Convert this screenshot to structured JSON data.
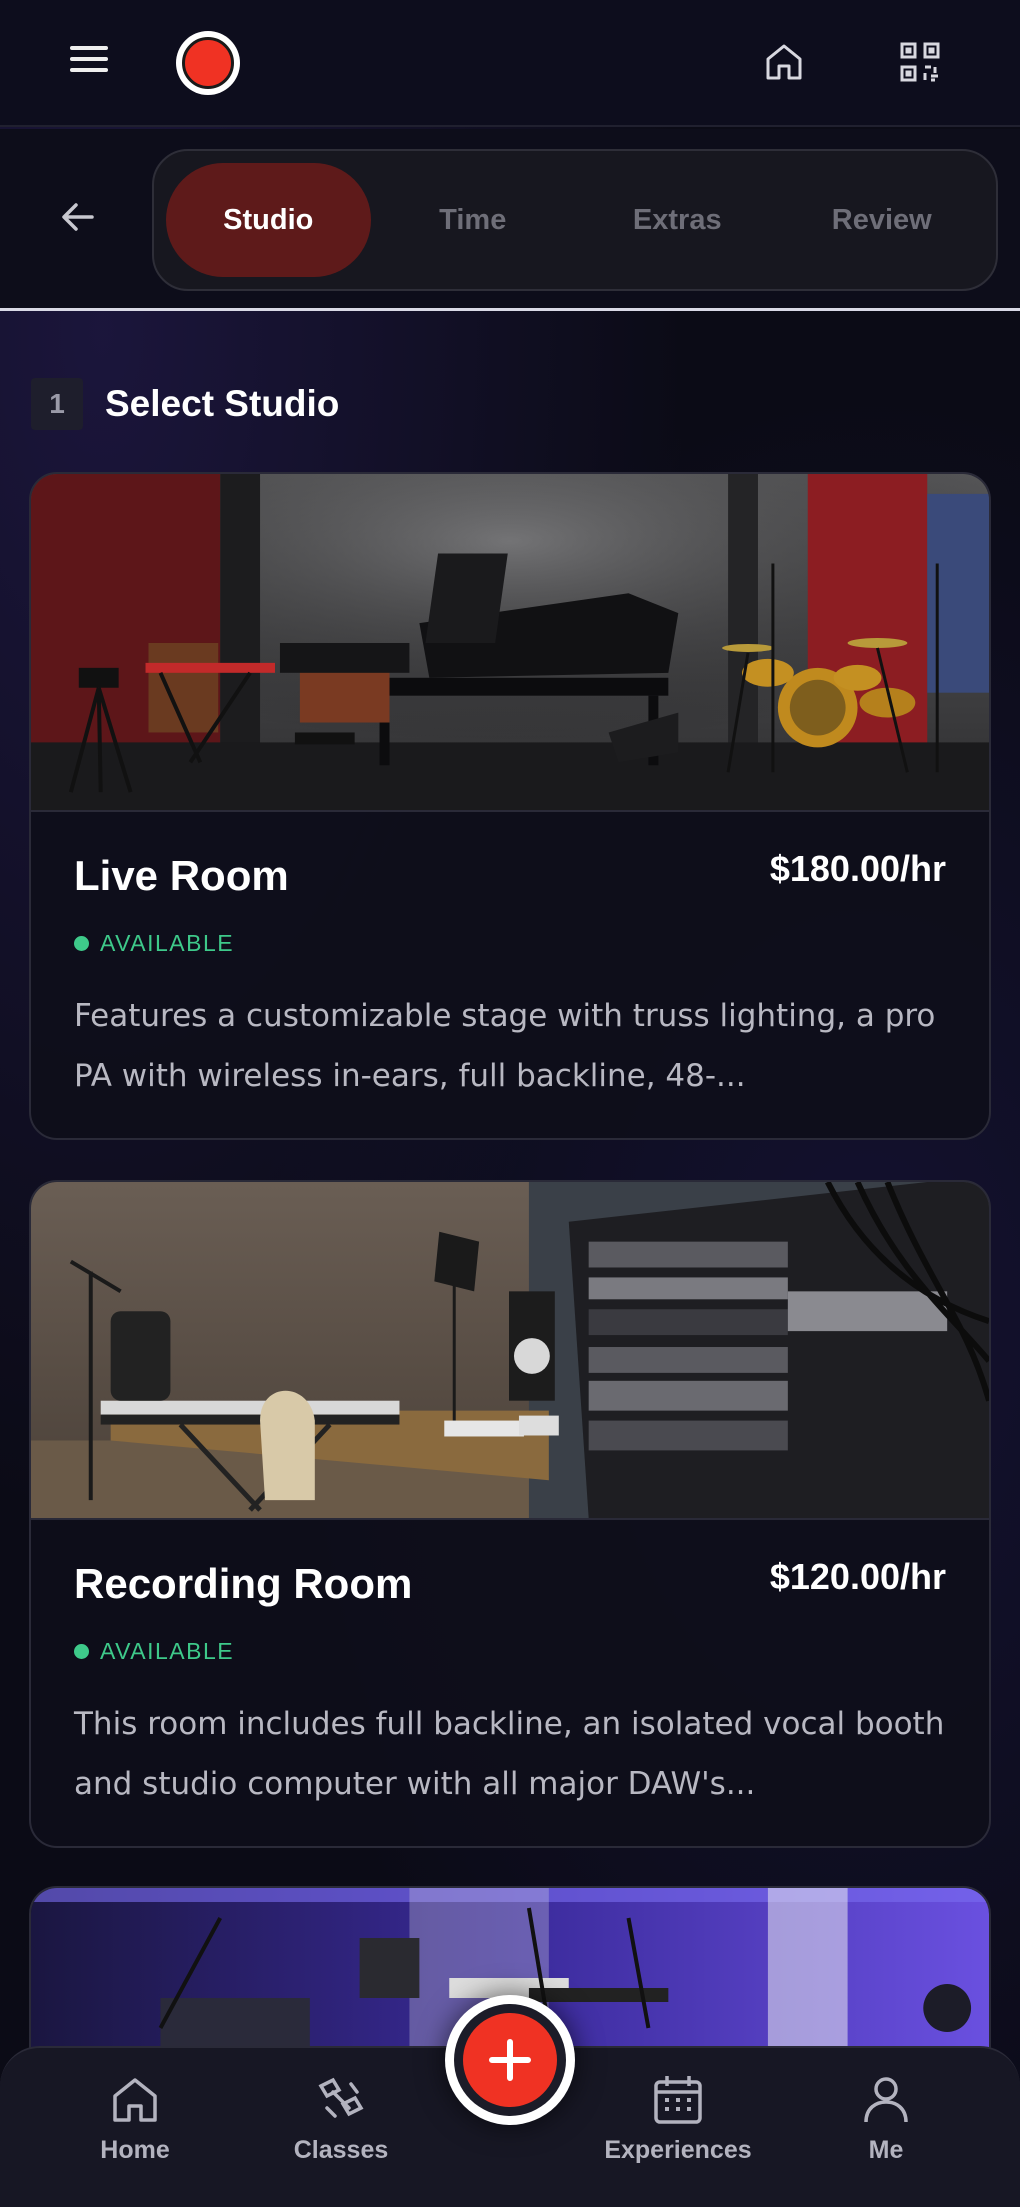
{
  "header": {
    "menu_icon": "hamburger-menu-icon",
    "logo_icon": "record-logo-icon",
    "home_icon": "home-icon",
    "qr_icon": "qr-code-icon"
  },
  "stepper": {
    "back_icon": "arrow-left-icon",
    "tabs": [
      {
        "label": "Studio",
        "active": true
      },
      {
        "label": "Time",
        "active": false
      },
      {
        "label": "Extras",
        "active": false
      },
      {
        "label": "Review",
        "active": false
      }
    ]
  },
  "section": {
    "step_number": "1",
    "title": "Select Studio"
  },
  "studios": [
    {
      "name": "Live Room",
      "price": "$180.00/hr",
      "status": "AVAILABLE",
      "description": "Features a customizable stage with truss lighting, a pro PA with wireless in-ears, full backline, 48-..."
    },
    {
      "name": "Recording Room",
      "price": "$120.00/hr",
      "status": "AVAILABLE",
      "description": "This room includes full backline, an isolated vocal booth and studio computer with all major DAW's..."
    }
  ],
  "bottom_nav": {
    "items": [
      {
        "label": "Home",
        "icon": "home-icon"
      },
      {
        "label": "Classes",
        "icon": "classes-icon"
      },
      {
        "label": "Experiences",
        "icon": "calendar-icon"
      },
      {
        "label": "Me",
        "icon": "person-icon"
      }
    ],
    "fab_icon": "plus-icon"
  },
  "colors": {
    "accent": "#f03223",
    "active_tab": "#5e1a1a",
    "available": "#3ec98a",
    "background": "#0b0b16"
  }
}
